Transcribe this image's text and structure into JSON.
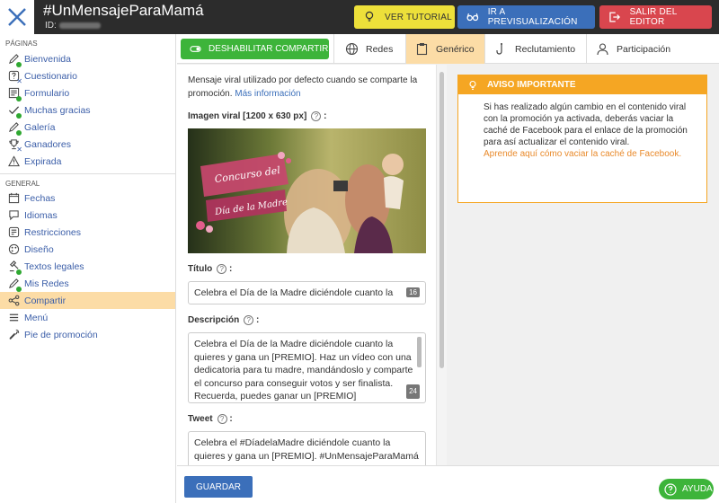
{
  "header": {
    "title": "#UnMensajeParaMamá",
    "id_label": "ID:",
    "buttons": {
      "tutorial": "VER TUTORIAL",
      "preview": "IR A PREVISUALIZACIÓN",
      "exit": "SALIR DEL EDITOR"
    }
  },
  "sidebar": {
    "pages_title": "PÁGINAS",
    "pages": [
      {
        "label": "Bienvenida",
        "icon": "pencil-icon",
        "status": "green"
      },
      {
        "label": "Cuestionario",
        "icon": "question-icon",
        "status": "x"
      },
      {
        "label": "Formulario",
        "icon": "form-icon",
        "status": "green"
      },
      {
        "label": "Muchas gracias",
        "icon": "check-icon",
        "status": "green"
      },
      {
        "label": "Galería",
        "icon": "pencil-icon",
        "status": "green"
      },
      {
        "label": "Ganadores",
        "icon": "trophy-icon",
        "status": "x"
      },
      {
        "label": "Expirada",
        "icon": "warning-icon",
        "status": ""
      }
    ],
    "general_title": "GENERAL",
    "general": [
      {
        "label": "Fechas",
        "icon": "calendar-icon",
        "status": ""
      },
      {
        "label": "Idiomas",
        "icon": "speech-icon",
        "status": ""
      },
      {
        "label": "Restricciones",
        "icon": "sliders-icon",
        "status": ""
      },
      {
        "label": "Diseño",
        "icon": "palette-icon",
        "status": ""
      },
      {
        "label": "Textos legales",
        "icon": "gavel-icon",
        "status": "green"
      },
      {
        "label": "Mis Redes",
        "icon": "pencil-icon",
        "status": "green"
      },
      {
        "label": "Compartir",
        "icon": "share-icon",
        "status": "",
        "active": true
      },
      {
        "label": "Menú",
        "icon": "menu-icon",
        "status": ""
      },
      {
        "label": "Pie de promoción",
        "icon": "wrench-icon",
        "status": ""
      }
    ]
  },
  "tabs": {
    "disable_label": "DESHABILITAR COMPARTIR",
    "items": [
      {
        "label": "Redes",
        "icon": "globe-icon"
      },
      {
        "label": "Genérico",
        "icon": "clipboard-icon",
        "active": true
      },
      {
        "label": "Reclutamiento",
        "icon": "hook-icon"
      },
      {
        "label": "Participación",
        "icon": "user-icon"
      }
    ]
  },
  "content": {
    "intro": "Mensaje viral utilizado por defecto cuando se comparte la promoción.",
    "intro_link": "Más información",
    "image_label": "Imagen viral [1200 x 630 px]",
    "image_banner_top": "Concurso del",
    "image_banner_bottom": "Día de la Madre",
    "title_label": "Título",
    "title_value": "Celebra el Día de la Madre diciéndole cuanto la",
    "title_counter": "16",
    "desc_label": "Descripción",
    "desc_value": "Celebra el Día de la Madre diciéndole cuanto la quieres y gana un [PREMIO]. Haz un vídeo con una dedicatoria para tu madre, mandándoslo y comparte el concurso para conseguir votos y ser finalista. Recuerda, puedes ganar un [PREMIO]",
    "desc_counter": "24",
    "tweet_label": "Tweet",
    "tweet_value": "Celebra el #DíadelaMadre diciéndole cuanto la quieres y gana un [PREMIO]. #UnMensajeParaMamá",
    "save": "GUARDAR"
  },
  "notice": {
    "title": "AVISO IMPORTANTE",
    "body": "Si has realizado algún cambio en el contenido viral con la promoción ya activada, deberás vaciar la caché de Facebook para el enlace de la promoción para así actualizar el contenido viral.",
    "link": "Aprende aquí cómo vaciar la caché de Facebook."
  },
  "help_button": "AYUDA",
  "colors": {
    "topbar": "#2c2c2c",
    "accent_active": "#fcdca6",
    "green": "#3db43a",
    "blue": "#3b6fba",
    "orange": "#f5a623",
    "red": "#d9464e",
    "yellow": "#ede03a"
  }
}
